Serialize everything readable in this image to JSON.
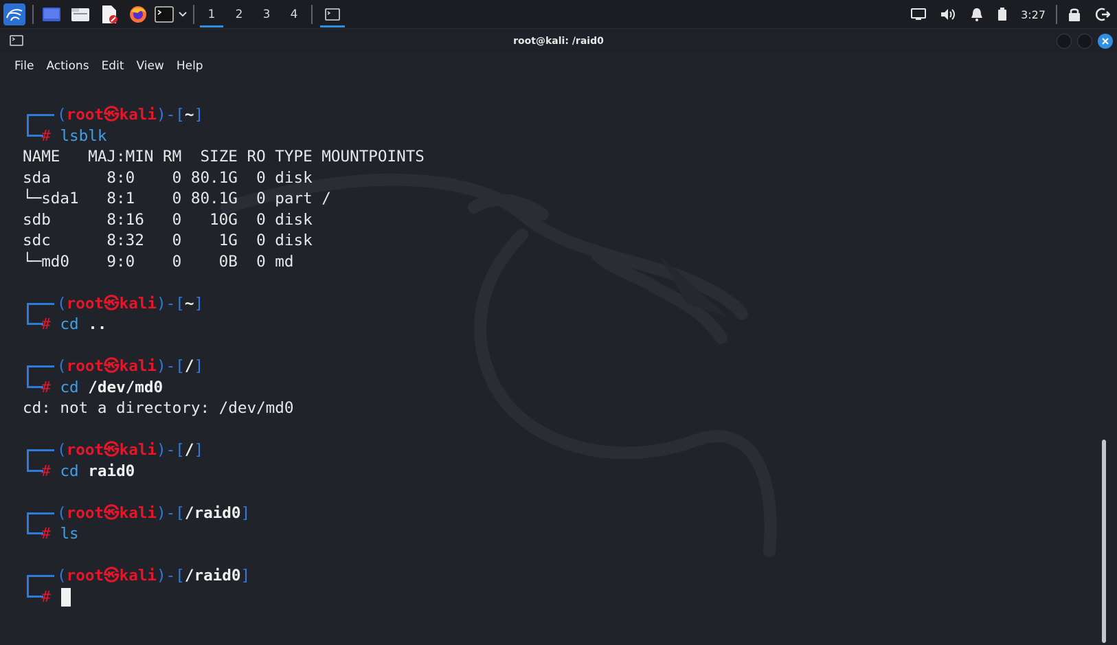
{
  "panel": {
    "workspaces": [
      "1",
      "2",
      "3",
      "4"
    ],
    "active_workspace": "1",
    "clock": "3:27",
    "icons": [
      "kali-menu-icon",
      "show-desktop-icon",
      "file-manager-icon",
      "text-editor-icon",
      "firefox-icon",
      "terminal-icon",
      "terminal-dropdown-icon",
      "terminal-task-icon",
      "display-icon",
      "volume-icon",
      "bell-icon",
      "battery-icon",
      "lock-icon",
      "logout-icon"
    ]
  },
  "window": {
    "title": "root@kali: /raid0"
  },
  "menu": {
    "file": "File",
    "actions": "Actions",
    "edit": "Edit",
    "view": "View",
    "help": "Help"
  },
  "prompt": {
    "user": "root",
    "at": "㉿",
    "host": "kali",
    "hash": "#"
  },
  "terminal": {
    "blocks": [
      {
        "cwd": "~",
        "command": "lsblk",
        "args": "",
        "output": [
          "NAME   MAJ:MIN RM  SIZE RO TYPE MOUNTPOINTS",
          "sda      8:0    0 80.1G  0 disk",
          "└─sda1   8:1    0 80.1G  0 part /",
          "sdb      8:16   0   10G  0 disk",
          "sdc      8:32   0    1G  0 disk",
          "└─md0    9:0    0    0B  0 md"
        ]
      },
      {
        "cwd": "~",
        "command": "cd",
        "args": "..",
        "output": []
      },
      {
        "cwd": "/",
        "command": "cd",
        "args": "/dev/md0",
        "output": [
          "cd: not a directory: /dev/md0"
        ]
      },
      {
        "cwd": "/",
        "command": "cd",
        "args": "raid0",
        "output": []
      },
      {
        "cwd": "/raid0",
        "command": "ls",
        "args": "",
        "output": []
      },
      {
        "cwd": "/raid0",
        "command": "",
        "args": "",
        "output": []
      }
    ]
  },
  "colors": {
    "accent": "#2f8fe0",
    "prompt_red": "#e3162a",
    "prompt_blue": "#2f7bdc",
    "background": "#20232a"
  }
}
